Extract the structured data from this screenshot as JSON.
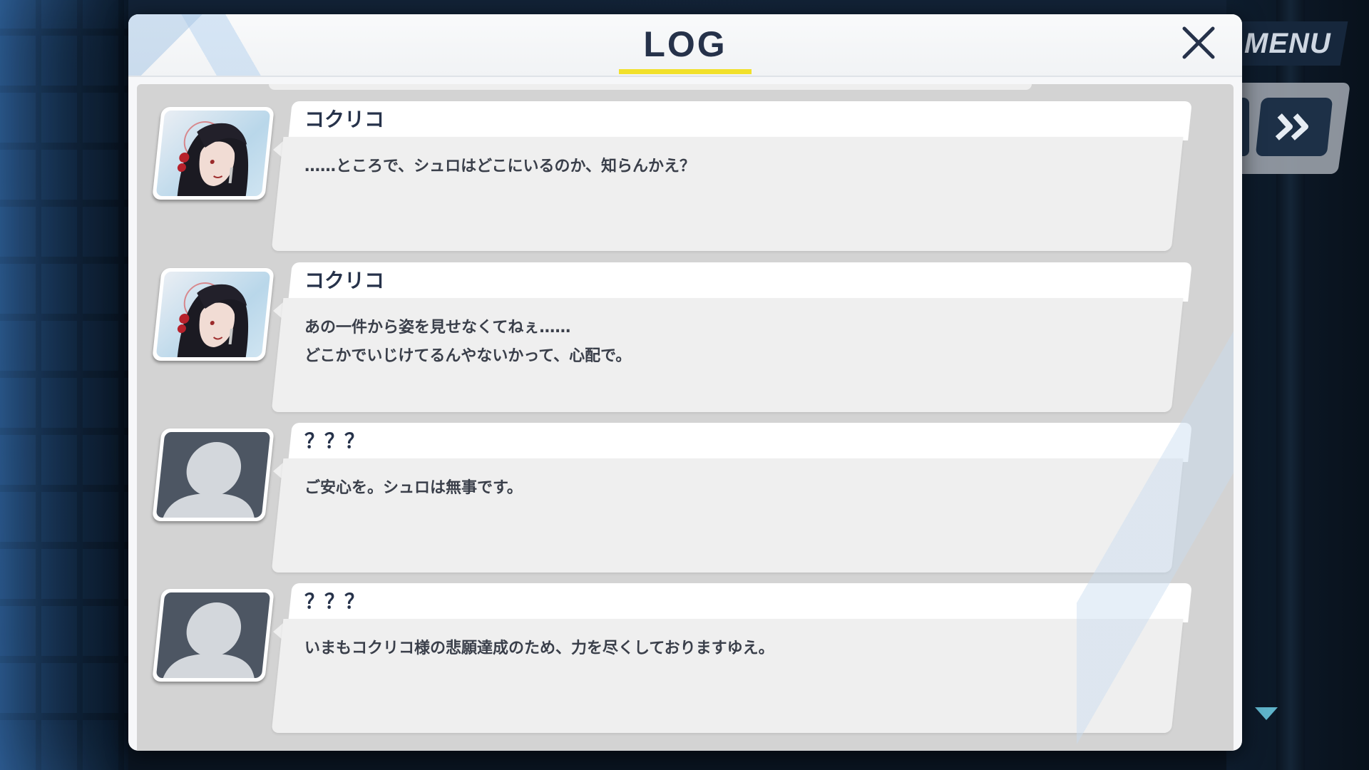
{
  "header": {
    "title": "LOG"
  },
  "side_controls": {
    "menu_label": "MENU",
    "skip_icon": "double-chevron-right-icon",
    "scroll_icon": "triangle-down-icon"
  },
  "log_entries": [
    {
      "speaker": "コクリコ",
      "portrait": "character",
      "lines": [
        "……ところで、シュロはどこにいるのか、知らんかえ？"
      ]
    },
    {
      "speaker": "コクリコ",
      "portrait": "character",
      "lines": [
        "あの一件から姿を見せなくてねぇ……",
        "どこかでいじけてるんやないかって、心配で。"
      ]
    },
    {
      "speaker": "？？？",
      "portrait": "silhouette",
      "lines": [
        "ご安心を。シュロは無事です。"
      ]
    },
    {
      "speaker": "？？？",
      "portrait": "silhouette",
      "lines": [
        "いまもコクリコ様の悲願達成のため、力を尽くしておりますゆえ。"
      ]
    }
  ],
  "colors": {
    "title": "#26324a",
    "title_underline": "#f1e02b",
    "dialog_bg": "#f6f7f9",
    "log_area_bg": "#d3d3d3",
    "control_dark": "#1d3047"
  }
}
